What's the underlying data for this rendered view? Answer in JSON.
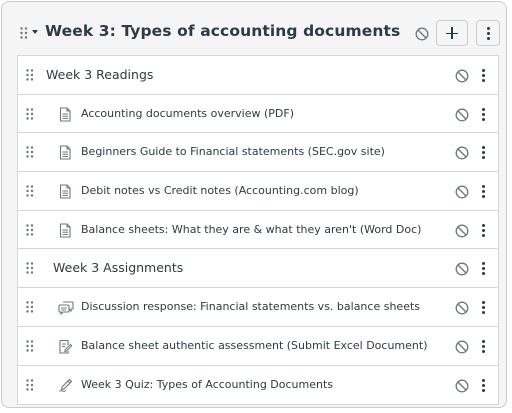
{
  "module": {
    "title": "Week 3: Types of accounting documents",
    "icons": [
      "drag-handle-icon",
      "caret-down-icon",
      "ban-icon",
      "plus-icon",
      "kebab-icon"
    ]
  },
  "items": [
    {
      "kind": "header",
      "label": "Week 3 Readings"
    },
    {
      "kind": "item",
      "icon": "document-icon",
      "label": "Accounting documents overview (PDF)"
    },
    {
      "kind": "item",
      "icon": "document-icon",
      "label": "Beginners Guide to Financial statements (SEC.gov site)"
    },
    {
      "kind": "item",
      "icon": "document-icon",
      "label": "Debit notes vs Credit notes (Accounting.com blog)"
    },
    {
      "kind": "item",
      "icon": "document-icon",
      "label": "Balance sheets: What they are & what they aren't (Word Doc)"
    },
    {
      "kind": "header",
      "label": "Week 3 Assignments"
    },
    {
      "kind": "item",
      "icon": "discussion-icon",
      "label": "Discussion response: Financial statements vs. balance sheets"
    },
    {
      "kind": "item",
      "icon": "assignment-icon",
      "label": "Balance sheet authentic assessment (Submit Excel Document)"
    },
    {
      "kind": "item",
      "icon": "quiz-icon",
      "label": "Week 3 Quiz: Types of Accounting Documents"
    }
  ],
  "colors": {
    "text": "#2d3b45",
    "border": "#c7cdd1",
    "icon": "#6b7780",
    "background": "#f5f5f5"
  }
}
